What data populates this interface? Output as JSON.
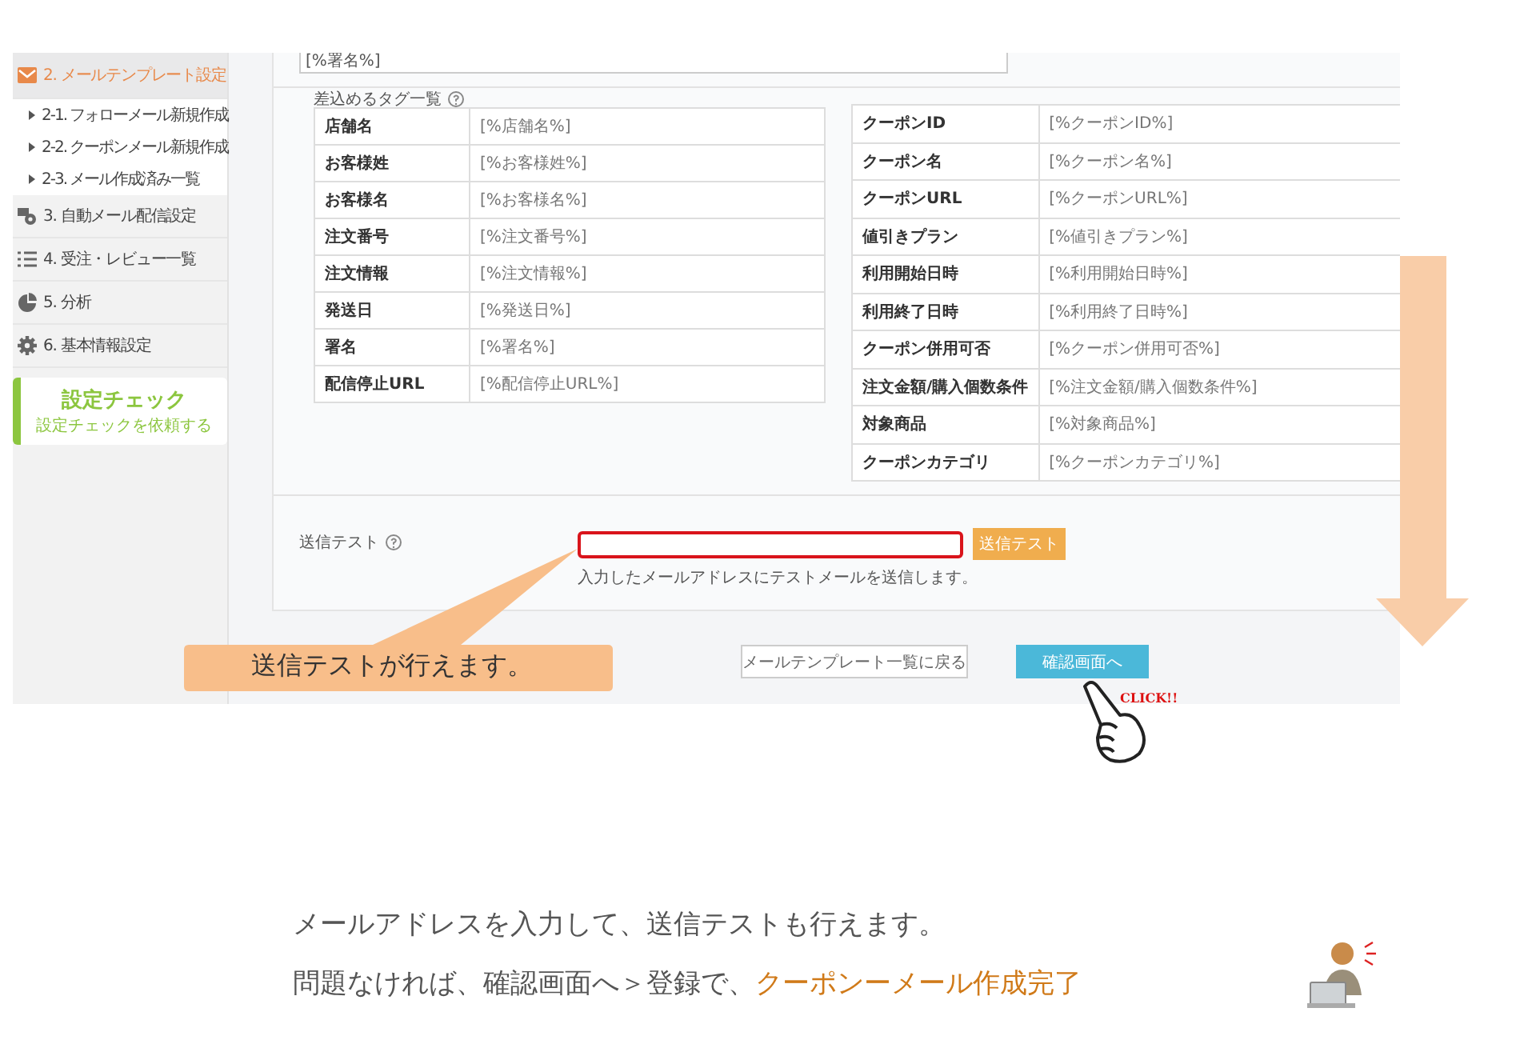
{
  "sidebar": {
    "items": [
      {
        "label": "2. メールテンプレート設定",
        "selected": true,
        "children": [
          {
            "label": "2-1. フォローメール新規作成",
            "selected": false
          },
          {
            "label": "2-2. クーポンメール新規作成",
            "selected": false
          },
          {
            "label": "2-3. メール作成済み一覧",
            "selected": false
          }
        ]
      },
      {
        "label": "3. 自動メール配信設定",
        "selected": false
      },
      {
        "label": "4. 受注・レビュー一覧",
        "selected": false
      },
      {
        "label": "5. 分析",
        "selected": false
      },
      {
        "label": "6. 基本情報設定",
        "selected": false
      }
    ],
    "check_card": {
      "title": "設定チェック",
      "subtitle": "設定チェックを依頼する"
    }
  },
  "signature_field": {
    "value": "[%署名%]"
  },
  "tags": {
    "title": "差込めるタグ一覧",
    "left_table": [
      {
        "name": "店舗名",
        "tag": "[%店舗名%]"
      },
      {
        "name": "お客様姓",
        "tag": "[%お客様姓%]"
      },
      {
        "name": "お客様名",
        "tag": "[%お客様名%]"
      },
      {
        "name": "注文番号",
        "tag": "[%注文番号%]"
      },
      {
        "name": "注文情報",
        "tag": "[%注文情報%]"
      },
      {
        "name": "発送日",
        "tag": "[%発送日%]"
      },
      {
        "name": "署名",
        "tag": "[%署名%]"
      },
      {
        "name": "配信停止URL",
        "tag": "[%配信停止URL%]"
      }
    ],
    "right_table": [
      {
        "name": "クーポンID",
        "tag": "[%クーポンID%]"
      },
      {
        "name": "クーポン名",
        "tag": "[%クーポン名%]"
      },
      {
        "name": "クーポンURL",
        "tag": "[%クーポンURL%]"
      },
      {
        "name": "値引きプラン",
        "tag": "[%値引きプラン%]"
      },
      {
        "name": "利用開始日時",
        "tag": "[%利用開始日時%]"
      },
      {
        "name": "利用終了日時",
        "tag": "[%利用終了日時%]"
      },
      {
        "name": "クーポン併用可否",
        "tag": "[%クーポン併用可否%]"
      },
      {
        "name": "注文金額/購入個数条件",
        "tag": "[%注文金額/購入個数条件%]"
      },
      {
        "name": "対象商品",
        "tag": "[%対象商品%]"
      },
      {
        "name": "クーポンカテゴリ",
        "tag": "[%クーポンカテゴリ%]"
      }
    ]
  },
  "send_test": {
    "label": "送信テスト",
    "highlighted": true,
    "button": "送信テスト",
    "hint": "入力したメールアドレスにテストメールを送信します。"
  },
  "buttons": {
    "back": "メールテンプレート一覧に戻る",
    "confirm": "確認画面へ"
  },
  "annotations": {
    "callout": "送信テストが行えます。",
    "click": "CLICK!!"
  },
  "captions": [
    [
      {
        "text": "メールアドレスを入力して、送信テストも行えます。",
        "emphasis": false
      }
    ],
    [
      {
        "text": "問題なければ、確認画面へ＞登録で、",
        "emphasis": false
      },
      {
        "text": "クーポンーメール作成完了",
        "emphasis": true
      }
    ]
  ]
}
